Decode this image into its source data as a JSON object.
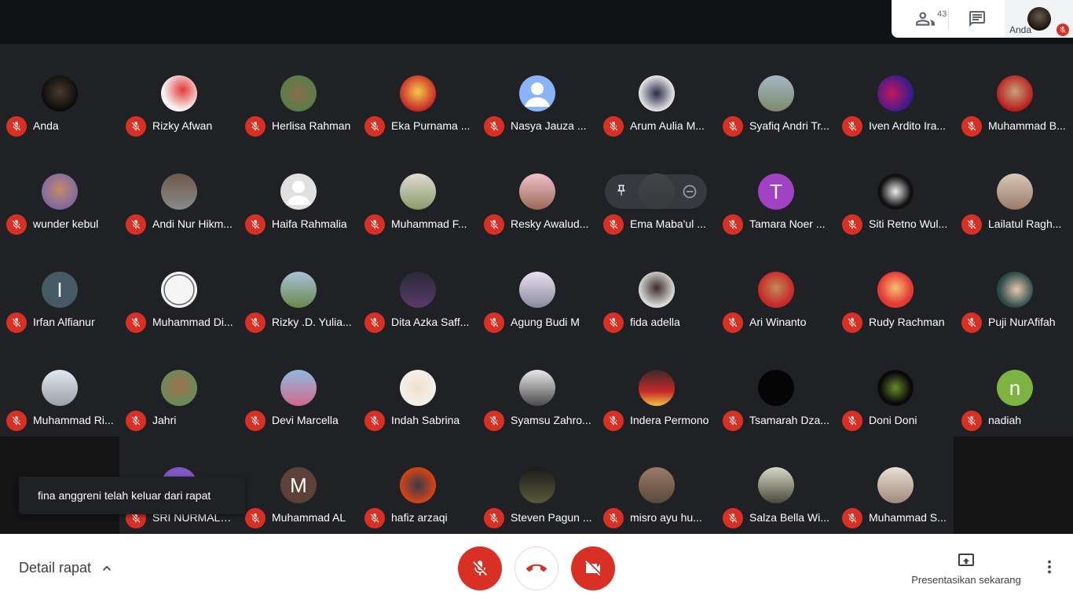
{
  "topbar": {
    "participants_count": "43",
    "self_label": "Anda"
  },
  "participants": [
    {
      "name": "Anda",
      "avatar": "photo-dark"
    },
    {
      "name": "Rizky Afwan",
      "avatar": "photo-red"
    },
    {
      "name": "Herlisa Rahman",
      "avatar": "photo-green"
    },
    {
      "name": "Eka Purnama ...",
      "avatar": "photo-yellow"
    },
    {
      "name": "Nasya Jauza ...",
      "avatar": "default-blue"
    },
    {
      "name": "Arum Aulia M...",
      "avatar": "photo-hijab"
    },
    {
      "name": "Syafiq Andri Tr...",
      "avatar": "photo-sign"
    },
    {
      "name": "Iven Ardito Ira...",
      "avatar": "photo-purple"
    },
    {
      "name": "Muhammad B...",
      "avatar": "photo-red2"
    },
    {
      "name": "wunder kebul",
      "avatar": "photo-person"
    },
    {
      "name": "Andi Nur Hikm...",
      "avatar": "photo-brown"
    },
    {
      "name": "Haifa Rahmalia",
      "avatar": "default-grey"
    },
    {
      "name": "Muhammad F...",
      "avatar": "photo-light"
    },
    {
      "name": "Resky Awalud...",
      "avatar": "photo-pink"
    },
    {
      "name": "Ema Maba'ul ...",
      "avatar": "photo-hover"
    },
    {
      "name": "Tamara Noer ...",
      "avatar": "letter",
      "letter": "T",
      "color": "#a142c5"
    },
    {
      "name": "Siti Retno Wul...",
      "avatar": "photo-bw"
    },
    {
      "name": "Lailatul Ragh...",
      "avatar": "photo-group"
    },
    {
      "name": "Irfan Alfianur",
      "avatar": "letter",
      "letter": "I",
      "color": "#455a64"
    },
    {
      "name": "Muhammad Di...",
      "avatar": "photo-logo"
    },
    {
      "name": "Rizky .D. Yulia...",
      "avatar": "photo-building"
    },
    {
      "name": "Dita Azka Saff...",
      "avatar": "photo-night"
    },
    {
      "name": "Agung Budi M",
      "avatar": "photo-sunset"
    },
    {
      "name": "fida adella",
      "avatar": "photo-flowers"
    },
    {
      "name": "Ari Winanto",
      "avatar": "photo-red3"
    },
    {
      "name": "Rudy Rachman",
      "avatar": "photo-red4"
    },
    {
      "name": "Puji NurAfifah",
      "avatar": "photo-teal"
    },
    {
      "name": "Muhammad Ri...",
      "avatar": "photo-white"
    },
    {
      "name": "Jahri",
      "avatar": "photo-man"
    },
    {
      "name": "Devi Marcella",
      "avatar": "photo-beach"
    },
    {
      "name": "Indah Sabrina",
      "avatar": "photo-hijab2"
    },
    {
      "name": "Syamsu Zahro...",
      "avatar": "photo-helmet"
    },
    {
      "name": "Indera Permono",
      "avatar": "photo-cartoon"
    },
    {
      "name": "Tsamarah Dza...",
      "avatar": "photo-black"
    },
    {
      "name": "Doni Doni",
      "avatar": "photo-logo2"
    },
    {
      "name": "nadiah",
      "avatar": "letter",
      "letter": "n",
      "color": "#7cb342"
    },
    {
      "name": "SRI NURMALA...",
      "avatar": "letter",
      "letter": "",
      "color": "#7e57c2"
    },
    {
      "name": "Muhammad AL",
      "avatar": "letter",
      "letter": "M",
      "color": "#5d4037"
    },
    {
      "name": "hafiz arzaqi",
      "avatar": "photo-anime"
    },
    {
      "name": "Steven Pagun ...",
      "avatar": "photo-dark2"
    },
    {
      "name": "misro ayu hu...",
      "avatar": "photo-tree"
    },
    {
      "name": "Salza Bella Wi...",
      "avatar": "photo-text"
    },
    {
      "name": "Muhammad S...",
      "avatar": "photo-light2"
    }
  ],
  "toast": {
    "text": "fina anggreni telah keluar dari rapat"
  },
  "bottombar": {
    "detail_label": "Detail rapat",
    "present_label": "Presentasikan sekarang"
  },
  "colors": {
    "red": "#d93025",
    "grid_bg": "#202124"
  }
}
